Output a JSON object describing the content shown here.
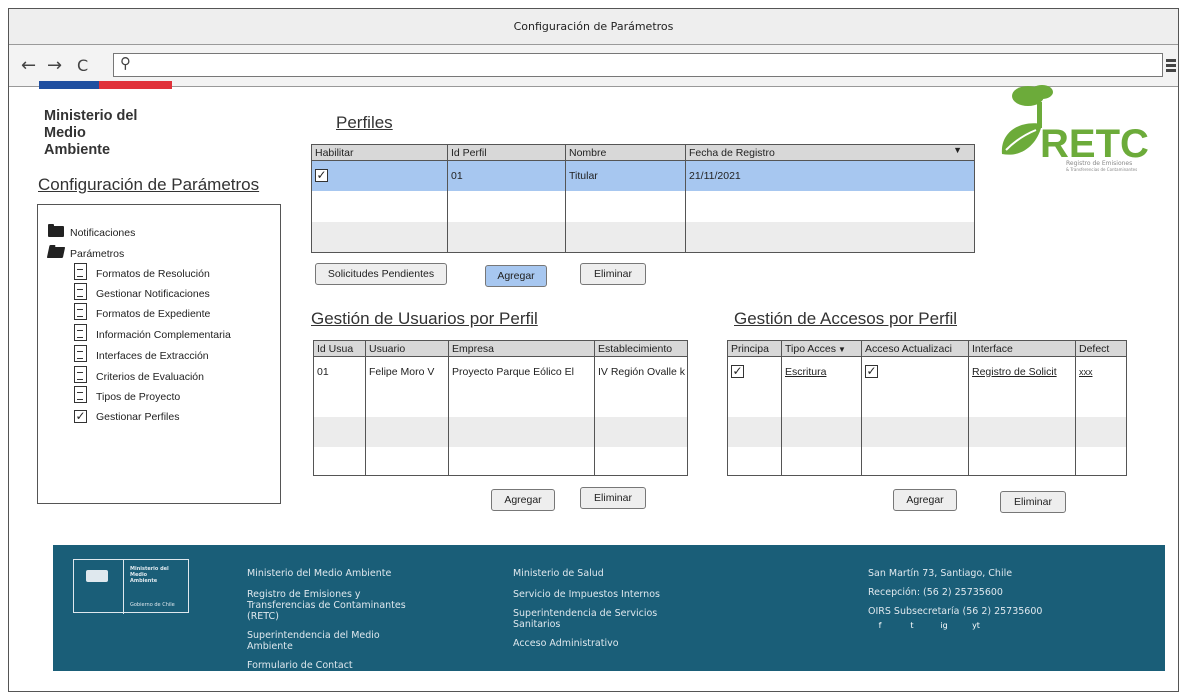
{
  "window": {
    "title": "Configuración de Parámetros"
  },
  "nav": {
    "back": "←",
    "forward": "→",
    "reload": "C",
    "search_glyph": "⚲",
    "url": ""
  },
  "brand": {
    "ministerio": [
      "Ministerio del",
      "Medio",
      "Ambiente"
    ],
    "flag_colors": [
      "#1f4fa0",
      "#e0323a"
    ]
  },
  "sidebar": {
    "title": "Configuración de Parámetros",
    "tree": [
      {
        "label": "Notificaciones",
        "type": "folder"
      },
      {
        "label": "Parámetros",
        "type": "folder-open"
      },
      {
        "label": "Formatos de Resolución",
        "type": "doc"
      },
      {
        "label": "Gestionar Notificaciones",
        "type": "doc"
      },
      {
        "label": "Formatos de Expediente",
        "type": "doc"
      },
      {
        "label": "Información Complementaria",
        "type": "doc"
      },
      {
        "label": "Interfaces de Extracción",
        "type": "doc"
      },
      {
        "label": "Criterios de Evaluación",
        "type": "doc"
      },
      {
        "label": "Tipos de Proyecto",
        "type": "doc"
      },
      {
        "label": "Gestionar Perfiles",
        "type": "checked"
      }
    ]
  },
  "perfiles": {
    "title": "Perfiles",
    "columns": [
      "Habilitar",
      "Id Perfil",
      "Nombre",
      "Fecha de Registro"
    ],
    "rows": [
      {
        "habilitar": true,
        "id": "01",
        "nombre": "Titular",
        "fecha": "21/11/2021"
      }
    ],
    "buttons": {
      "pendientes": "Solicitudes Pendientes",
      "agregar": "Agregar",
      "eliminar": "Eliminar"
    }
  },
  "usuarios": {
    "title": "Gestión de Usuarios por Perfil",
    "columns": [
      "Id Usua",
      "Usuario",
      "Empresa",
      "Establecimiento"
    ],
    "rows": [
      {
        "id": "01",
        "usuario": "Felipe Moro V",
        "empresa": "Proyecto Parque Eólico El",
        "establecimiento": "IV Región Ovalle k"
      }
    ],
    "buttons": {
      "agregar": "Agregar",
      "eliminar": "Eliminar"
    }
  },
  "accesos": {
    "title": "Gestión de Accesos por Perfil",
    "columns": [
      "Principa",
      "Tipo Acces",
      "Acceso Actualizaci",
      "Interface",
      "Defect"
    ],
    "rows": [
      {
        "principal": true,
        "tipo": "Escritura",
        "actualizacion": true,
        "interface": "Registro de Solicit",
        "defecto": "xxx"
      }
    ],
    "buttons": {
      "agregar": "Agregar",
      "eliminar": "Eliminar"
    }
  },
  "logo": {
    "retc": "RETC",
    "sub1": "Registro de Emisiones",
    "sub2": "& Transferencias de Contaminantes"
  },
  "footer": {
    "logo_lines": [
      "Ministerio del",
      "Medio",
      "Ambiente"
    ],
    "logo_sub": "Gobierno de Chile",
    "col1": [
      "Ministerio del Medio Ambiente",
      "Registro de Emisiones y",
      "Transferencias de Contaminantes",
      "(RETC)",
      "Superintendencia del Medio",
      "Ambiente",
      "Formulario de Contact"
    ],
    "col2": [
      "Ministerio de Salud",
      "Servicio de Impuestos Internos",
      "Superintendencia de Servicios",
      "Sanitarios",
      "Acceso Administrativo"
    ],
    "col3": [
      "San Martín 73, Santiago, Chile",
      "Recepción: (56 2) 25735600",
      "OIRS Subsecretaría (56 2) 25735600"
    ],
    "social": [
      "f",
      "t",
      "ig",
      "yt"
    ],
    "bg_color": "#1a5e78"
  }
}
